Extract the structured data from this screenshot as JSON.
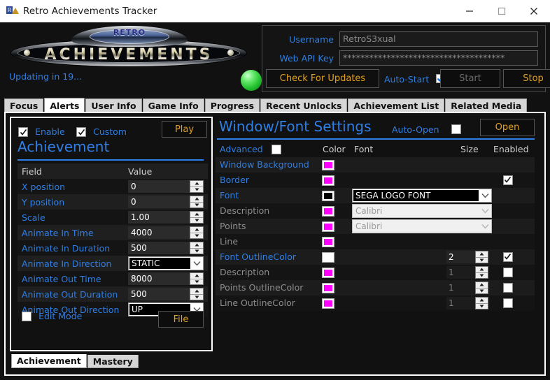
{
  "window": {
    "title": "Retro Achievements Tracker",
    "icon": "app-icon",
    "minimize": "minimize-icon",
    "maximize": "maximize-icon",
    "close": "close-icon"
  },
  "header": {
    "logo_top_text": "RETRO",
    "logo_main_text": "ACHIEVEMENTS",
    "status_text": "Updating in 19...",
    "status_led_color": "#3fd34a"
  },
  "account": {
    "username_label": "Username",
    "username_value": "RetroS3xual",
    "apikey_label": "Web API Key",
    "apikey_value": "*************************************",
    "check_updates_label": "Check For Updates",
    "autostart_label": "Auto-Start",
    "autostart_checked": true,
    "start_label": "Start",
    "stop_label": "Stop"
  },
  "tabs": [
    {
      "label": "Focus",
      "active": false
    },
    {
      "label": "Alerts",
      "active": true
    },
    {
      "label": "User Info",
      "active": false
    },
    {
      "label": "Game Info",
      "active": false
    },
    {
      "label": "Progress",
      "active": false
    },
    {
      "label": "Recent Unlocks",
      "active": false
    },
    {
      "label": "Achievement List",
      "active": false
    },
    {
      "label": "Related Media",
      "active": false
    }
  ],
  "left_panel": {
    "enable_label": "Enable",
    "enable_checked": true,
    "custom_label": "Custom",
    "custom_checked": true,
    "play_label": "Play",
    "title": "Achievement",
    "col_field": "Field",
    "col_value": "Value",
    "rows": [
      {
        "field": "X position",
        "value": "0",
        "type": "spinner"
      },
      {
        "field": "Y position",
        "value": "0",
        "type": "spinner"
      },
      {
        "field": "Scale",
        "value": "1.00",
        "type": "spinner"
      },
      {
        "field": "Animate In Time",
        "value": "4000",
        "type": "spinner"
      },
      {
        "field": "Animate In Duration",
        "value": "500",
        "type": "spinner"
      },
      {
        "field": "Animate In Direction",
        "value": "STATIC",
        "type": "combo"
      },
      {
        "field": "Animate Out Time",
        "value": "8000",
        "type": "spinner"
      },
      {
        "field": "Animate Out Duration",
        "value": "500",
        "type": "spinner"
      },
      {
        "field": "Animate Out Direction",
        "value": "UP",
        "type": "combo"
      }
    ],
    "edit_mode_label": "Edit Mode",
    "edit_mode_checked": false,
    "file_label": "File",
    "subtabs": [
      {
        "label": "Achievement",
        "active": true
      },
      {
        "label": "Mastery",
        "active": false
      }
    ]
  },
  "right_panel": {
    "title": "Window/Font Settings",
    "auto_open_label": "Auto-Open",
    "auto_open_checked": false,
    "open_label": "Open",
    "advanced_label": "Advanced",
    "advanced_checked": false,
    "col_color": "Color",
    "col_font": "Font",
    "col_size": "Size",
    "col_enabled": "Enabled",
    "rows": [
      {
        "name": "Window Background",
        "dim": false,
        "color": "#FF00FF",
        "font": null,
        "font_dim": false,
        "size": null,
        "size_dim": false,
        "enabled": null
      },
      {
        "name": "Border",
        "dim": false,
        "color": "#FF00FF",
        "font": null,
        "font_dim": false,
        "size": null,
        "size_dim": false,
        "enabled": true
      },
      {
        "name": "Font",
        "dim": false,
        "color": "#000000",
        "font": "SEGA LOGO FONT",
        "font_dim": false,
        "size": null,
        "size_dim": false,
        "enabled": null
      },
      {
        "name": "Description",
        "dim": true,
        "color": "#FF00FF",
        "font": "Calibri",
        "font_dim": true,
        "size": null,
        "size_dim": false,
        "enabled": null
      },
      {
        "name": "Points",
        "dim": true,
        "color": "#FF00FF",
        "font": "Calibri",
        "font_dim": true,
        "size": null,
        "size_dim": false,
        "enabled": null
      },
      {
        "name": "Line",
        "dim": true,
        "color": "#FF00FF",
        "font": null,
        "font_dim": false,
        "size": null,
        "size_dim": false,
        "enabled": null
      },
      {
        "name": "Font OutlineColor",
        "dim": false,
        "color": "#FFFFFF",
        "font": null,
        "font_dim": false,
        "size": "2",
        "size_dim": false,
        "enabled": true
      },
      {
        "name": "Description",
        "dim": true,
        "color": "#FF00FF",
        "font": null,
        "font_dim": false,
        "size": "1",
        "size_dim": true,
        "enabled": false
      },
      {
        "name": "Points OutlineColor",
        "dim": true,
        "color": "#FF00FF",
        "font": null,
        "font_dim": false,
        "size": "1",
        "size_dim": true,
        "enabled": false
      },
      {
        "name": "Line OutlineColor",
        "dim": true,
        "color": "#FF00FF",
        "font": null,
        "font_dim": false,
        "size": "1",
        "size_dim": true,
        "enabled": false
      }
    ]
  },
  "colors": {
    "accent_blue": "#2f7fe6",
    "accent_gold": "#e0a022",
    "magenta": "#FF00FF",
    "background": "#111111"
  }
}
